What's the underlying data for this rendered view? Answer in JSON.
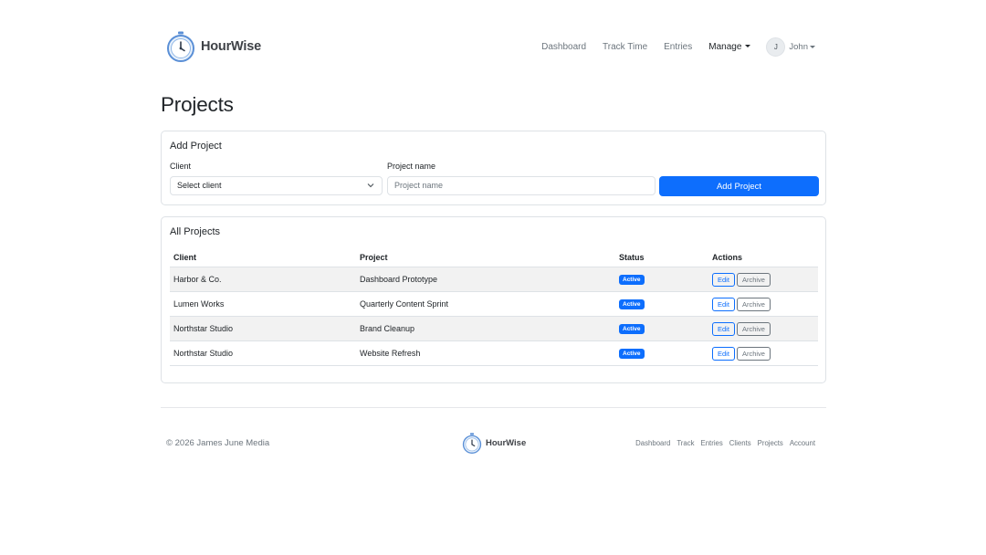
{
  "brand": {
    "name": "HourWise"
  },
  "nav": {
    "links": [
      "Dashboard",
      "Track Time",
      "Entries"
    ],
    "manage": "Manage",
    "user_initial": "J",
    "user_name": "John"
  },
  "page_title": "Projects",
  "add_project": {
    "title": "Add Project",
    "client_label": "Client",
    "client_selected": "Select client",
    "name_label": "Project name",
    "name_placeholder": "Project name",
    "submit_label": "Add Project"
  },
  "all_projects": {
    "title": "All Projects",
    "headers": [
      "Client",
      "Project",
      "Status",
      "Actions"
    ],
    "rows": [
      {
        "client": "Harbor & Co.",
        "project": "Dashboard Prototype",
        "status": "Active"
      },
      {
        "client": "Lumen Works",
        "project": "Quarterly Content Sprint",
        "status": "Active"
      },
      {
        "client": "Northstar Studio",
        "project": "Brand Cleanup",
        "status": "Active"
      },
      {
        "client": "Northstar Studio",
        "project": "Website Refresh",
        "status": "Active"
      }
    ],
    "edit_label": "Edit",
    "archive_label": "Archive"
  },
  "footer": {
    "copyright": "© 2026 James June Media",
    "brand": "HourWise",
    "links": [
      "Dashboard",
      "Track",
      "Entries",
      "Clients",
      "Projects",
      "Account"
    ]
  },
  "colors": {
    "primary": "#0d6efd",
    "muted": "#6c757d",
    "border": "#dee2e6",
    "stripe": "#f2f2f2"
  }
}
